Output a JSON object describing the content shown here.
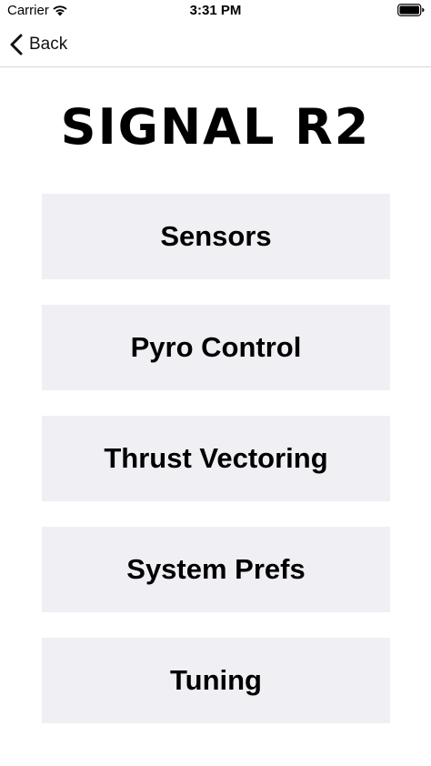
{
  "status_bar": {
    "carrier": "Carrier",
    "time": "3:31 PM",
    "icons": [
      "wifi-icon",
      "battery-icon"
    ]
  },
  "nav": {
    "back_label": "Back",
    "back_icon": "chevron-left-icon"
  },
  "title": "SIGNAL R2",
  "menu": {
    "items": [
      {
        "label": "Sensors"
      },
      {
        "label": "Pyro Control"
      },
      {
        "label": "Thrust Vectoring"
      },
      {
        "label": "System Prefs"
      },
      {
        "label": "Tuning"
      }
    ],
    "button_color": "#efeff4"
  }
}
